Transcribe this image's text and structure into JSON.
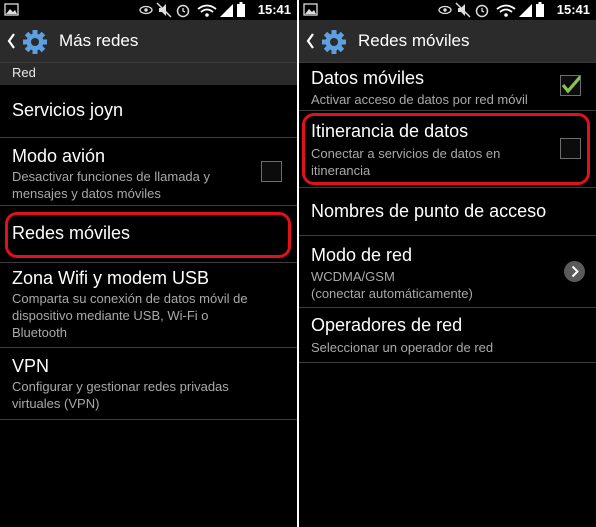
{
  "status": {
    "time": "15:41"
  },
  "left": {
    "header": {
      "title": "Más redes"
    },
    "section": "Red",
    "items": [
      {
        "title": "Servicios joyn"
      },
      {
        "title": "Modo avión",
        "subtitle1": "Desactivar funciones de llamada y",
        "subtitle2": "mensajes y datos móviles",
        "checked": false
      },
      {
        "title": "Redes móviles"
      },
      {
        "title": "Zona Wifi y modem USB",
        "subtitle1": "Comparta su conexión de datos móvil de",
        "subtitle2": "dispositivo mediante USB, Wi-Fi o",
        "subtitle3": "Bluetooth"
      },
      {
        "title": "VPN",
        "subtitle1": "Configurar y gestionar redes privadas",
        "subtitle2": "virtuales (VPN)"
      }
    ]
  },
  "right": {
    "header": {
      "title": "Redes móviles"
    },
    "items": [
      {
        "title": "Datos móviles",
        "subtitle1": "Activar acceso de datos por red móvil",
        "checked": true
      },
      {
        "title": "Itinerancia de datos",
        "subtitle1": "Conectar a servicios de datos en",
        "subtitle2": "itinerancia",
        "checked": false
      },
      {
        "title": "Nombres de punto de acceso"
      },
      {
        "title": "Modo de red",
        "subtitle1": "WCDMA/GSM",
        "subtitle2": "(conectar automáticamente)"
      },
      {
        "title": "Operadores de red",
        "subtitle1": "Seleccionar un operador de red"
      }
    ]
  },
  "colors": {
    "highlight": "#e0111b",
    "check": "#8bc34a",
    "gear": "#5d9fe0"
  }
}
